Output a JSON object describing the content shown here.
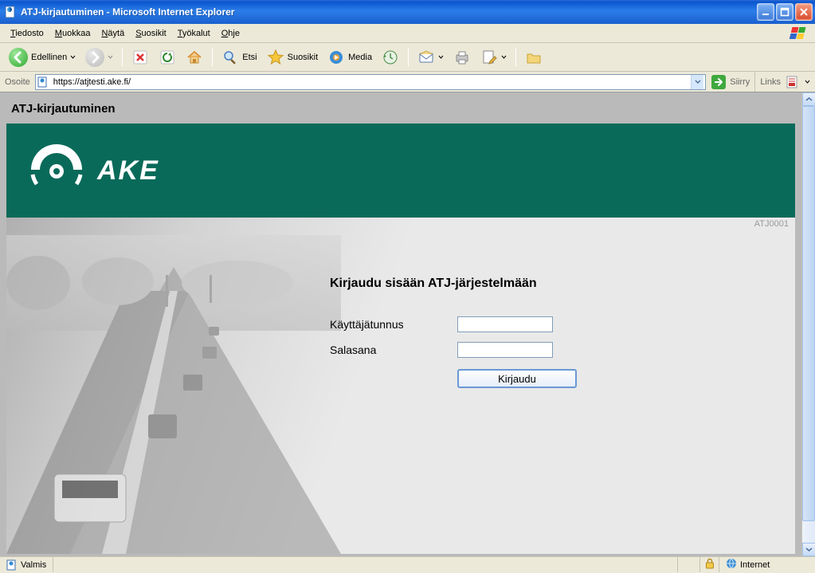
{
  "window": {
    "title": "ATJ-kirjautuminen - Microsoft Internet Explorer"
  },
  "menu": {
    "items": [
      {
        "label": "Tiedosto",
        "accel_index": 0
      },
      {
        "label": "Muokkaa",
        "accel_index": 0
      },
      {
        "label": "Näytä",
        "accel_index": 0
      },
      {
        "label": "Suosikit",
        "accel_index": 0
      },
      {
        "label": "Työkalut",
        "accel_index": 0
      },
      {
        "label": "Ohje",
        "accel_index": 0
      }
    ]
  },
  "toolbar": {
    "back_label": "Edellinen",
    "search_label": "Etsi",
    "favorites_label": "Suosikit",
    "media_label": "Media"
  },
  "address": {
    "label": "Osoite",
    "url": "https://atjtesti.ake.fi/",
    "go_label": "Siirry",
    "links_label": "Links"
  },
  "page": {
    "heading": "ATJ-kirjautuminen",
    "brand": "AKE",
    "code": "ATJ0001",
    "login_heading": "Kirjaudu sisään ATJ-järjestelmään",
    "username_label": "Käyttäjätunnus",
    "password_label": "Salasana",
    "submit_label": "Kirjaudu"
  },
  "status": {
    "ready": "Valmis",
    "zone": "Internet"
  },
  "colors": {
    "banner": "#0a6a5a",
    "titlebar": "#1a5fce",
    "button_border": "#6a98d6"
  }
}
